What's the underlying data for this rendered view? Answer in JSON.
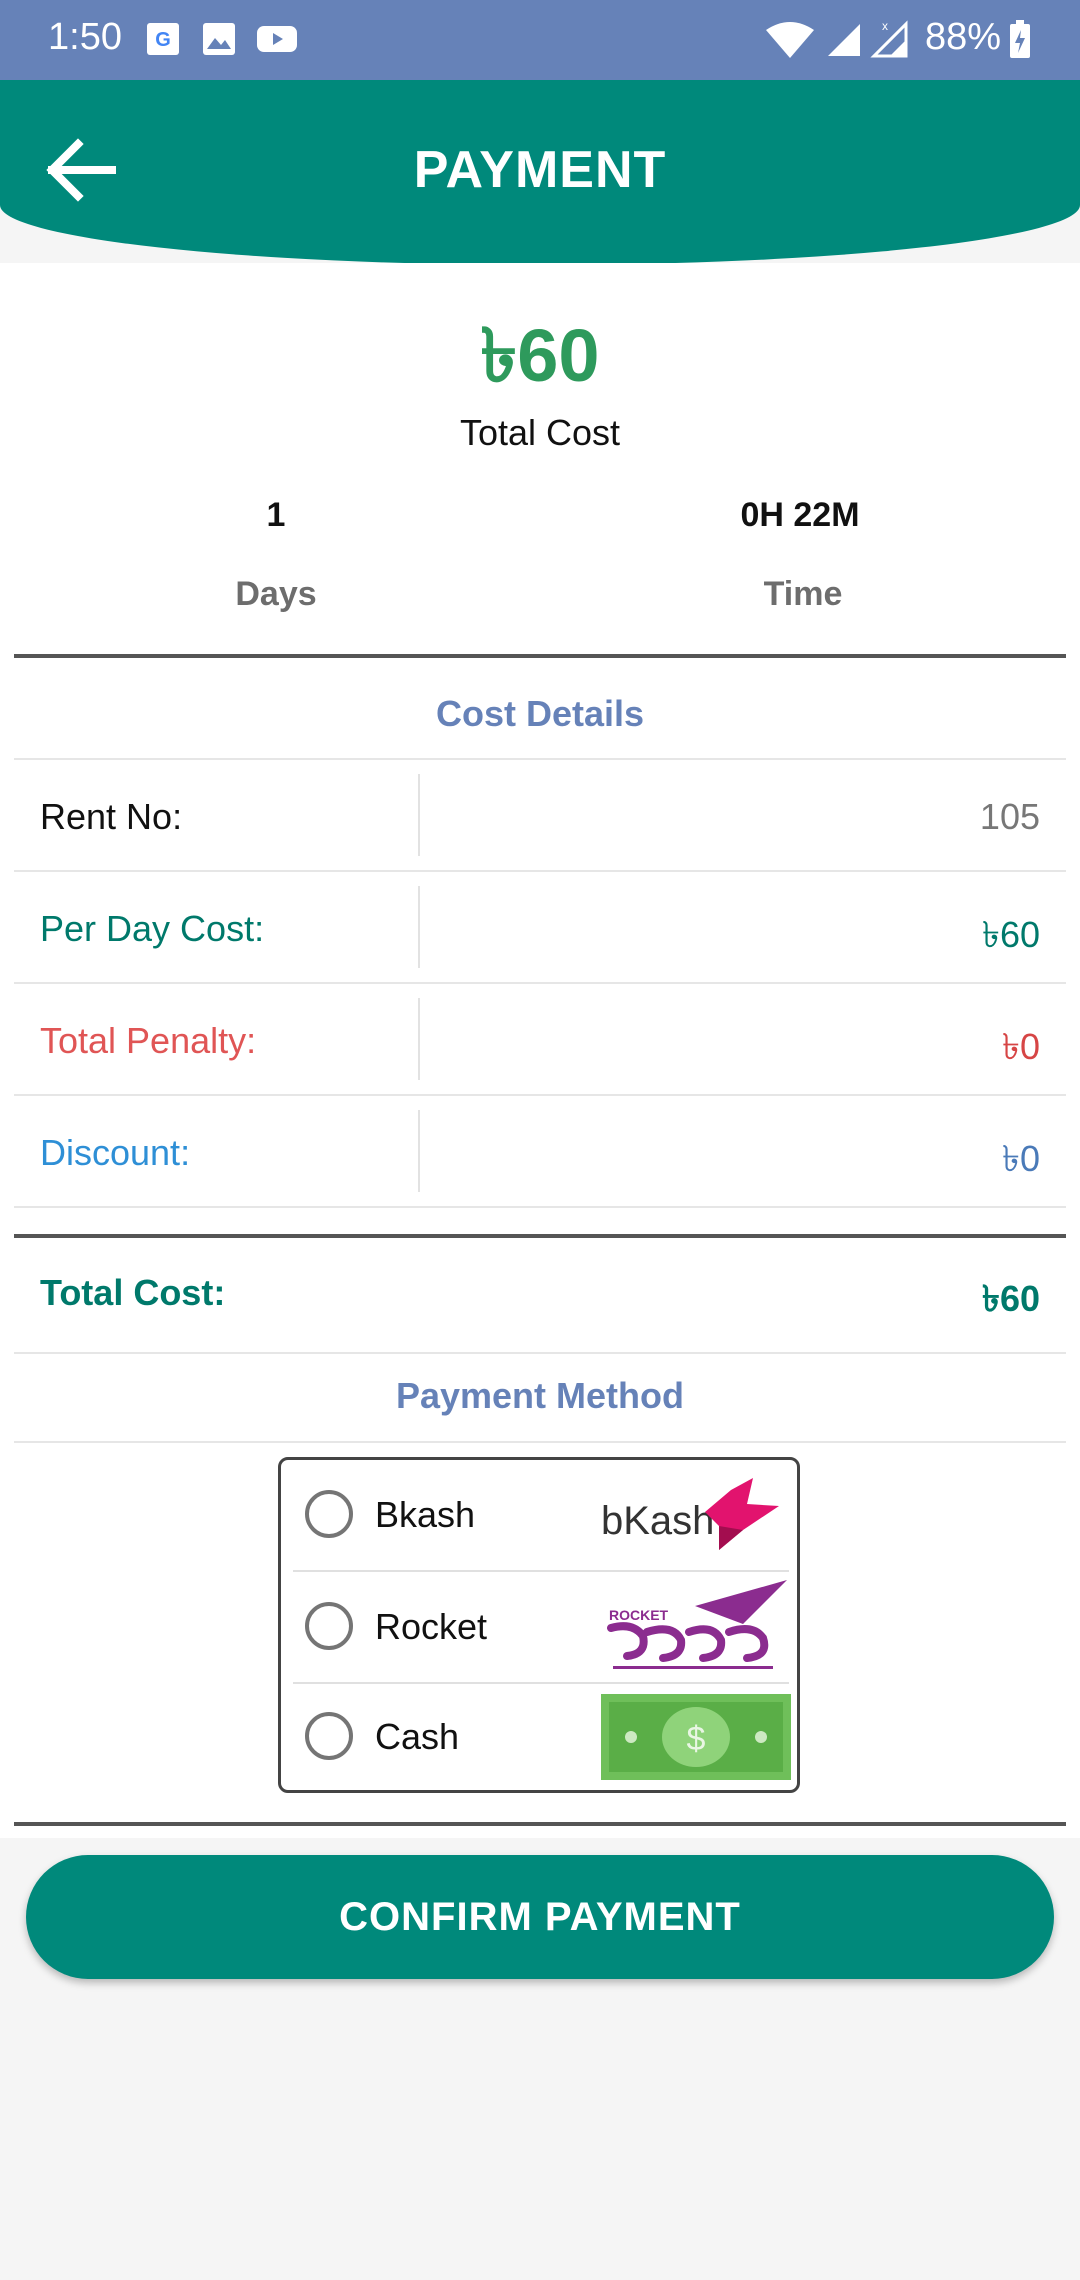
{
  "status_bar": {
    "time": "1:50",
    "battery": "88%"
  },
  "header": {
    "title": "PAYMENT"
  },
  "summary": {
    "amount": "৳60",
    "amount_label": "Total Cost",
    "days_value": "1",
    "days_label": "Days",
    "time_value": "0H 22M",
    "time_label": "Time"
  },
  "cost_details": {
    "title": "Cost Details",
    "rows": [
      {
        "label": "Rent No:",
        "value": "105",
        "color": "#111111"
      },
      {
        "label": "Per Day Cost:",
        "value": "৳60",
        "color": "#00796b"
      },
      {
        "label": "Total Penalty:",
        "value": "৳0",
        "color": "#e05555"
      },
      {
        "label": "Discount:",
        "value": "৳0",
        "color": "#2e8fd6"
      }
    ],
    "total_label": "Total Cost:",
    "total_value": "৳60"
  },
  "payment_method": {
    "title": "Payment Method",
    "options": [
      {
        "label": "Bkash",
        "logo_text": "bKash",
        "icon": "bkash-logo",
        "selected": false
      },
      {
        "label": "Rocket",
        "logo_text": "ROCKET",
        "icon": "rocket-logo",
        "selected": false
      },
      {
        "label": "Cash",
        "logo_text": "$",
        "icon": "cash-logo",
        "selected": false
      }
    ]
  },
  "confirm_button": {
    "label": "CONFIRM PAYMENT"
  }
}
